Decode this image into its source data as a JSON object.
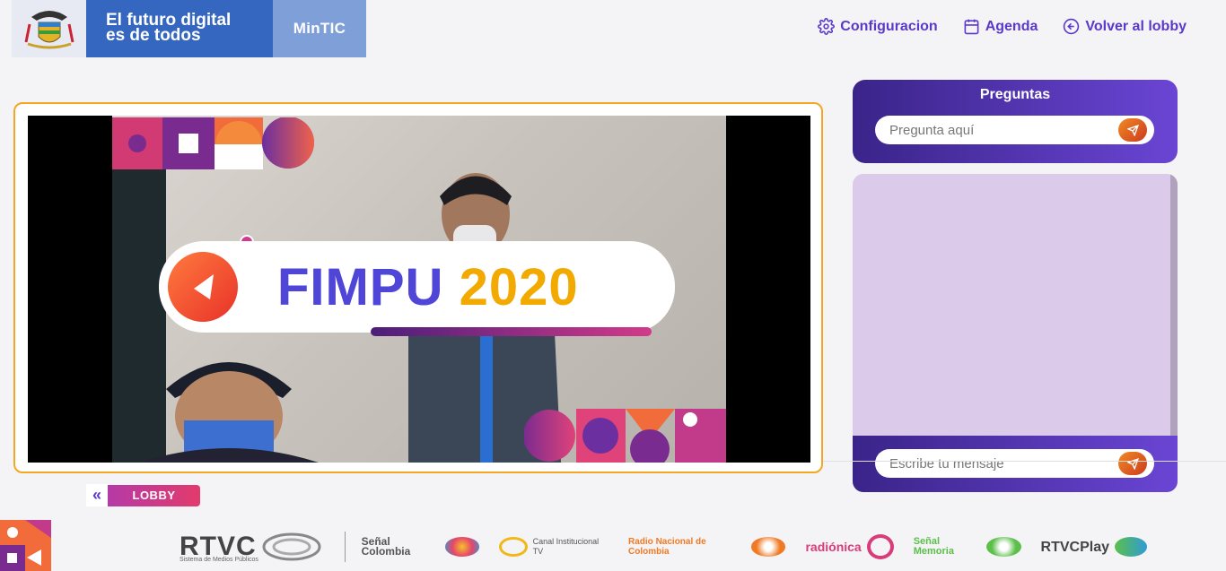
{
  "header": {
    "brand_line1": "El futuro digital",
    "brand_line2": "es de todos",
    "brand_mintic": "MinTIC",
    "nav": [
      {
        "label": "Configuracion",
        "icon": "gear-icon"
      },
      {
        "label": "Agenda",
        "icon": "calendar-icon"
      },
      {
        "label": "Volver al lobby",
        "icon": "arrow-left-circle-icon"
      }
    ]
  },
  "video": {
    "title_main": "FIMPU",
    "title_year": "2020"
  },
  "lobby_button": {
    "label": "LOBBY"
  },
  "questions": {
    "title": "Preguntas",
    "placeholder": "Pregunta aquí"
  },
  "chat": {
    "placeholder": "Escribe tu mensaje"
  },
  "footer": {
    "logos": [
      {
        "name": "RTVC",
        "sub": "Sistema de Medios Públicos"
      },
      {
        "name": "Señal Colombia"
      },
      {
        "name": "Canal Institucional TV"
      },
      {
        "name": "Radio Nacional de Colombia"
      },
      {
        "name": "radiónica"
      },
      {
        "name": "Señal Memoria"
      },
      {
        "name": "RTVCPlay"
      }
    ]
  },
  "colors": {
    "accent": "#5a38c9",
    "frame": "#f5a623",
    "panel_gradient_start": "#3a2489",
    "panel_gradient_end": "#6a45d4",
    "chat_bg": "#dccaea"
  }
}
